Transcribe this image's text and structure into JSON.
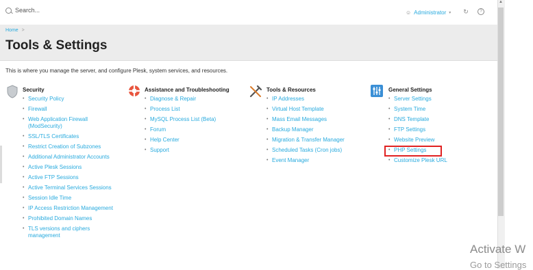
{
  "topbar": {
    "search_placeholder": "Search...",
    "user_label": "Administrator",
    "user_caret": "▾"
  },
  "header": {
    "breadcrumb": "Home",
    "breadcrumb_sep": ">",
    "title": "Tools & Settings"
  },
  "intro": "This is where you manage the server, and configure Plesk, system services, and resources.",
  "columns": [
    {
      "title": "Security",
      "icon": "shield-icon",
      "items": [
        "Security Policy",
        "Firewall",
        "Web Application Firewall (ModSecurity)",
        "SSL/TLS Certificates",
        "Restrict Creation of Subzones",
        "Additional Administrator Accounts",
        "Active Plesk Sessions",
        "Active FTP Sessions",
        "Active Terminal Services Sessions",
        "Session Idle Time",
        "IP Access Restriction Management",
        "Prohibited Domain Names",
        "TLS versions and ciphers management"
      ]
    },
    {
      "title": "Assistance and Troubleshooting",
      "icon": "lifebuoy-icon",
      "items": [
        "Diagnose & Repair",
        "Process List",
        "MySQL Process List (Beta)",
        "Forum",
        "Help Center",
        "Support"
      ]
    },
    {
      "title": "Tools & Resources",
      "icon": "tools-icon",
      "items": [
        "IP Addresses",
        "Virtual Host Template",
        "Mass Email Messages",
        "Backup Manager",
        "Migration & Transfer Manager",
        "Scheduled Tasks (Cron jobs)",
        "Event Manager"
      ]
    },
    {
      "title": "General Settings",
      "icon": "settings-sliders-icon",
      "items": [
        "Server Settings",
        "System Time",
        "DNS Template",
        "FTP Settings",
        "Website Preview",
        "PHP Settings",
        "Customize Plesk URL"
      ]
    }
  ],
  "watermark": {
    "line1": "Activate W",
    "line2": "Go to Settings"
  },
  "colors": {
    "link": "#28aade",
    "highlight": "#e02020",
    "header_bg": "#ececec"
  }
}
